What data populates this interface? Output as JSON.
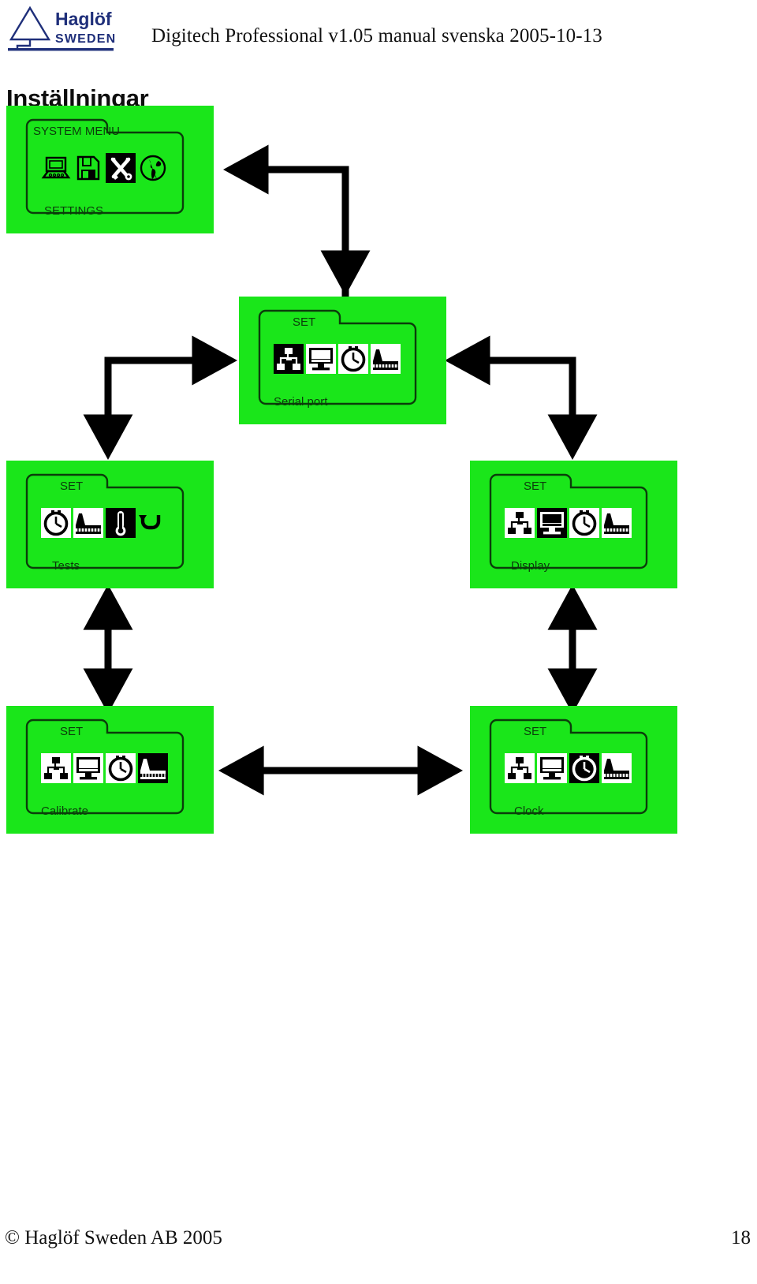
{
  "header": {
    "logo_alt": "Haglof Sweden",
    "logo_brand": "Haglöf",
    "logo_sub": "SWEDEN",
    "doc_title": "Digitech Professional v1.05 manual svenska 2005-10-13"
  },
  "page_title": "Inställningar",
  "colors": {
    "screen_green": "#1ae61a",
    "screen_text": "#0b3d0b",
    "ink": "#000000",
    "logo_blue": "#1f2f7a"
  },
  "diagram": {
    "type": "flow",
    "screens": [
      {
        "id": "system-menu",
        "title": "SYSTEM MENU",
        "caption": "SETTINGS",
        "icon_style": "outline",
        "icons": [
          {
            "name": "laptop-icon",
            "selected": false
          },
          {
            "name": "floppy-disk-icon",
            "selected": false
          },
          {
            "name": "tools-icon",
            "selected": true
          },
          {
            "name": "globe-icon",
            "selected": false
          }
        ]
      },
      {
        "id": "serial-port",
        "title": "SET",
        "caption": "Serial port",
        "icon_style": "filled",
        "icons": [
          {
            "name": "network-icon",
            "selected": true
          },
          {
            "name": "monitor-icon",
            "selected": false
          },
          {
            "name": "clock-icon",
            "selected": false
          },
          {
            "name": "ruler-icon",
            "selected": false
          }
        ]
      },
      {
        "id": "tests",
        "title": "SET",
        "caption": "Tests",
        "icon_style": "filled",
        "icons": [
          {
            "name": "clock-icon",
            "selected": false
          },
          {
            "name": "ruler-icon",
            "selected": false
          },
          {
            "name": "thermometer-icon",
            "selected": true
          },
          {
            "name": "back-arrow-icon",
            "selected": false
          }
        ]
      },
      {
        "id": "display",
        "title": "SET",
        "caption": "Display",
        "icon_style": "filled",
        "icons": [
          {
            "name": "network-icon",
            "selected": false
          },
          {
            "name": "monitor-icon",
            "selected": true
          },
          {
            "name": "clock-icon",
            "selected": false
          },
          {
            "name": "ruler-icon",
            "selected": false
          }
        ]
      },
      {
        "id": "calibrate",
        "title": "SET",
        "caption": "Calibrate",
        "icon_style": "filled",
        "icons": [
          {
            "name": "network-icon",
            "selected": false
          },
          {
            "name": "monitor-icon",
            "selected": false
          },
          {
            "name": "clock-icon",
            "selected": false
          },
          {
            "name": "ruler-icon",
            "selected": true
          }
        ]
      },
      {
        "id": "clock",
        "title": "SET",
        "caption": "Clock",
        "icon_style": "filled",
        "icons": [
          {
            "name": "network-icon",
            "selected": false
          },
          {
            "name": "monitor-icon",
            "selected": false
          },
          {
            "name": "clock-icon",
            "selected": true
          },
          {
            "name": "ruler-icon",
            "selected": false
          }
        ]
      }
    ],
    "connections": [
      {
        "from": "serial-port",
        "to": "system-menu",
        "style": "single"
      },
      {
        "from": "system-menu",
        "to": "serial-port",
        "style": "single"
      },
      {
        "from": "serial-port",
        "to": "tests",
        "style": "single"
      },
      {
        "from": "serial-port",
        "to": "display",
        "style": "single"
      },
      {
        "from": "tests",
        "to": "calibrate",
        "style": "double"
      },
      {
        "from": "display",
        "to": "clock",
        "style": "double"
      },
      {
        "from": "calibrate",
        "to": "clock",
        "style": "double"
      }
    ]
  },
  "footer": {
    "copyright": "© Haglöf Sweden AB 2005",
    "page_number": "18"
  }
}
